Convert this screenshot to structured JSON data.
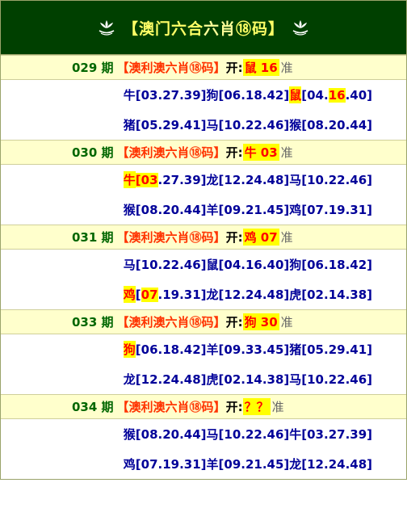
{
  "header": {
    "title_pre": "【澳门六合",
    "title_hl": "六肖",
    "title_post": "⑱码】"
  },
  "periods": [
    {
      "num": "029 期",
      "name": "【澳利澳六肖⑱码】",
      "kai": "开:",
      "result": "鼠 16",
      "zhun": "准",
      "lines": [
        [
          {
            "t": "牛[03.27.39]"
          },
          {
            "t": "狗[06.18.42]"
          },
          {
            "t": "鼠",
            "h": true
          },
          {
            "t": "[04."
          },
          {
            "t": "16",
            "h": true
          },
          {
            "t": ".40]"
          }
        ],
        [
          {
            "t": "猪[05.29.41]"
          },
          {
            "t": "马[10.22.46]"
          },
          {
            "t": "猴[08.20.44]"
          }
        ]
      ]
    },
    {
      "num": "030 期",
      "name": "【澳利澳六肖⑱码】",
      "kai": "开:",
      "result": "牛 03",
      "zhun": "准",
      "lines": [
        [
          {
            "t": "牛",
            "h": true
          },
          {
            "t": "[",
            "h": true
          },
          {
            "t": "03",
            "h": true
          },
          {
            "t": ".27.39]"
          },
          {
            "t": "龙[12.24.48]"
          },
          {
            "t": "马[10.22.46]"
          }
        ],
        [
          {
            "t": "猴[08.20.44]"
          },
          {
            "t": "羊[09.21.45]"
          },
          {
            "t": "鸡[07.19.31]"
          }
        ]
      ]
    },
    {
      "num": "031 期",
      "name": "【澳利澳六肖⑱码】",
      "kai": "开:",
      "result": "鸡 07",
      "zhun": "准",
      "lines": [
        [
          {
            "t": "马[10.22.46]"
          },
          {
            "t": "鼠[04.16.40]"
          },
          {
            "t": "狗[06.18.42]"
          }
        ],
        [
          {
            "t": "鸡",
            "h": true
          },
          {
            "t": "["
          },
          {
            "t": "07",
            "h": true
          },
          {
            "t": ".19.31]"
          },
          {
            "t": "龙[12.24.48]"
          },
          {
            "t": "虎[02.14.38]"
          }
        ]
      ]
    },
    {
      "num": "033 期",
      "name": "【澳利澳六肖⑱码】",
      "kai": "开:",
      "result": "狗 30",
      "zhun": "准",
      "lines": [
        [
          {
            "t": "狗",
            "h": true
          },
          {
            "t": "[06.18.42]"
          },
          {
            "t": "羊[09.33.45]"
          },
          {
            "t": "猪[05.29.41]"
          }
        ],
        [
          {
            "t": "龙[12.24.48]"
          },
          {
            "t": "虎[02.14.38]"
          },
          {
            "t": "马[10.22.46]"
          }
        ]
      ]
    },
    {
      "num": "034 期",
      "name": "【澳利澳六肖⑱码】",
      "kai": "开:",
      "result": "？？",
      "zhun": "准",
      "lines": [
        [
          {
            "t": "猴[08.20.44]"
          },
          {
            "t": "马[10.22.46]"
          },
          {
            "t": "牛[03.27.39]"
          }
        ],
        [
          {
            "t": "鸡[07.19.31]"
          },
          {
            "t": "羊[09.21.45]"
          },
          {
            "t": "龙[12.24.48]"
          }
        ]
      ]
    }
  ],
  "colors": {
    "header_bg": "#004000",
    "title": "#ffff66",
    "period_bg": "#ffffcc",
    "period_num": "#006600",
    "period_name": "#ff3300",
    "highlight_bg": "#ffff00",
    "highlight_text": "#ff0000",
    "line_text": "#000099"
  }
}
